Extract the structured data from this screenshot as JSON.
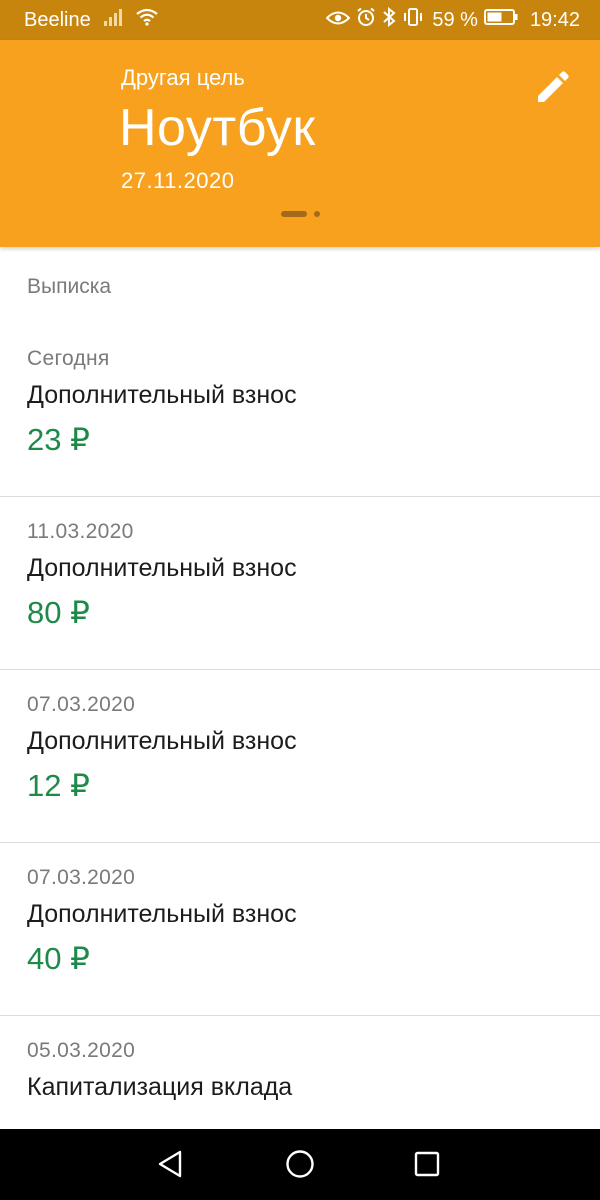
{
  "status_bar": {
    "carrier": "Beeline",
    "battery_percent": "59 %",
    "time": "19:42",
    "icons": [
      "signal-icon",
      "wifi-icon",
      "eye-icon",
      "alarm-icon",
      "bluetooth-icon",
      "vibrate-icon",
      "battery-icon"
    ]
  },
  "header": {
    "category": "Другая цель",
    "title": "Ноутбук",
    "date": "27.11.2020",
    "background_color": "#f7a11e",
    "pager_pages": 2,
    "pager_current": 1
  },
  "statement": {
    "title": "Выписка",
    "entries": [
      {
        "date": "Сегодня",
        "description": "Дополнительный взнос",
        "amount": "23 ₽"
      },
      {
        "date": "11.03.2020",
        "description": "Дополнительный взнос",
        "amount": "80 ₽"
      },
      {
        "date": "07.03.2020",
        "description": "Дополнительный взнос",
        "amount": "12 ₽"
      },
      {
        "date": "07.03.2020",
        "description": "Дополнительный взнос",
        "amount": "40 ₽"
      },
      {
        "date": "05.03.2020",
        "description": "Капитализация вклада",
        "amount": ""
      }
    ],
    "amount_color": "#1d8a4a"
  },
  "nav_bar": {
    "buttons": [
      "back-icon",
      "home-icon",
      "recents-icon"
    ]
  }
}
